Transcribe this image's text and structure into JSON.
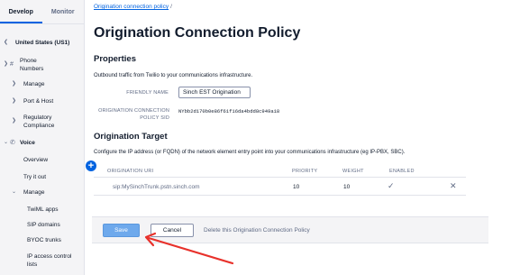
{
  "sidebar": {
    "tabs": [
      {
        "label": "Develop",
        "active": true
      },
      {
        "label": "Monitor",
        "active": false
      }
    ],
    "region": "United States (US1)",
    "items": {
      "phone_numbers": "Phone Numbers",
      "manage": "Manage",
      "port_host": "Port & Host",
      "regulatory": "Regulatory Compliance",
      "voice": "Voice",
      "overview": "Overview",
      "try_it_out": "Try it out",
      "voice_manage": "Manage",
      "twiml_apps": "TwiML apps",
      "sip_domains": "SIP domains",
      "byoc_trunks": "BYOC trunks",
      "ip_access": "IP access control lists"
    }
  },
  "breadcrumb": {
    "link": "Origination connection policy",
    "separator": "/"
  },
  "page_title": "Origination Connection Policy",
  "properties": {
    "heading": "Properties",
    "description": "Outbound traffic from Twilio to your communications infrastructure.",
    "friendly_name_label": "FRIENDLY NAME",
    "friendly_name_value": "Sinch EST Origination",
    "sid_label": "ORIGINATION CONNECTION POLICY SID",
    "sid_value": "NYbb2d170b0e86f61f16da4bdd8c949a18"
  },
  "origination_target": {
    "heading": "Origination Target",
    "description": "Configure the IP address (or FQDN) of the network element entry point into your communications infrastructure (eg IP-PBX, SBC).",
    "columns": [
      "ORIGINATION URI",
      "PRIORITY",
      "WEIGHT",
      "ENABLED"
    ],
    "rows": [
      {
        "uri": "sip:MySinchTrunk.pstn.sinch.com",
        "priority": "10",
        "weight": "10",
        "enabled": true
      }
    ]
  },
  "footer": {
    "save_label": "Save",
    "cancel_label": "Cancel",
    "delete_label": "Delete this Origination Connection Policy"
  },
  "colors": {
    "accent": "#0263e0",
    "save_button": "#6ea9ec",
    "annotation_arrow": "#e8312b"
  },
  "icons": [
    "chevron-left-icon",
    "hash-icon",
    "chevron-right-icon",
    "chevron-down-icon",
    "phone-icon",
    "plus-icon",
    "checkmark-icon",
    "close-icon",
    "arrow-annotation"
  ]
}
